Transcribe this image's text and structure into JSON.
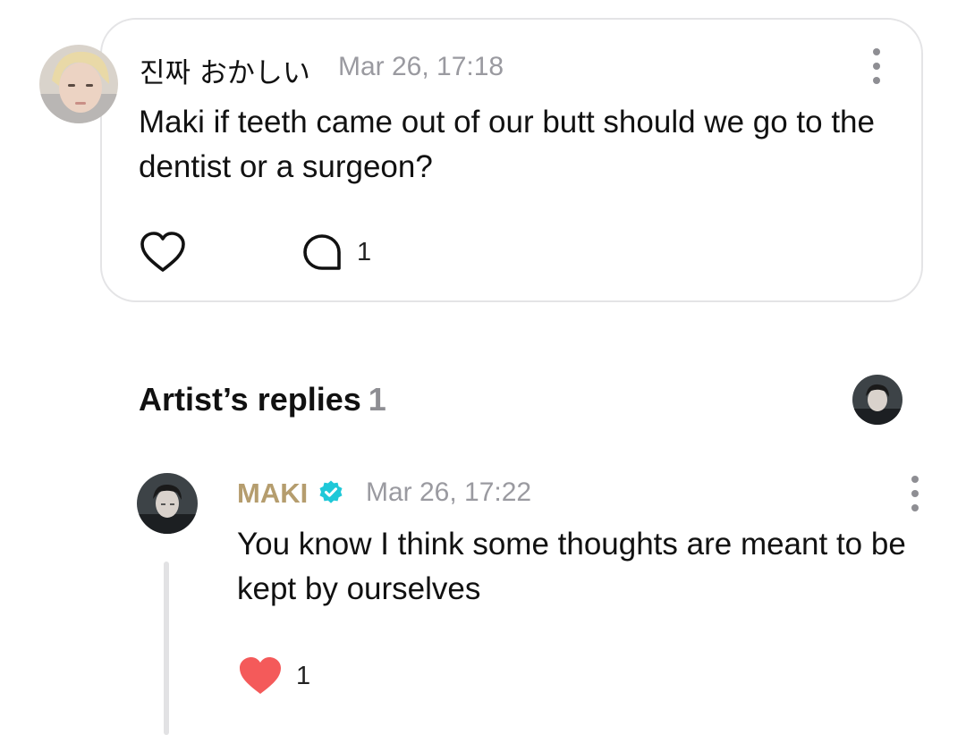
{
  "post": {
    "author": "진짜 おかしい",
    "timestamp": "Mar 26, 17:18",
    "text": "Maki if teeth came out of our butt should we go to the dentist or a surgeon?",
    "comment_count": "1",
    "icons": {
      "more": "more-vertical-icon",
      "like": "heart-outline-icon",
      "comment": "comment-bubble-icon"
    }
  },
  "artist_replies": {
    "title": "Artist’s replies",
    "count": "1",
    "reply": {
      "author": "MAKI",
      "verified_icon": "verified-check-icon",
      "timestamp": "Mar 26, 17:22",
      "text": "You know I think some thoughts are meant to be kept by ourselves",
      "like_count": "1",
      "icons": {
        "more": "more-vertical-icon",
        "like": "heart-filled-icon"
      }
    }
  },
  "colors": {
    "artist_name": "#b59d6e",
    "verified": "#1fc8d8",
    "liked_heart": "#f45a5a",
    "muted_text": "#9a9aa0",
    "card_border": "#e4e4e6"
  }
}
